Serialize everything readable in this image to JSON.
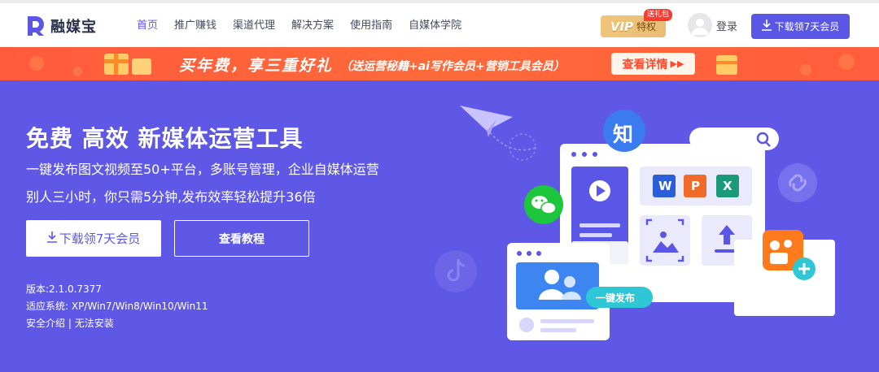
{
  "brand": {
    "name": "融媒宝",
    "logo_color": "#5b57e6"
  },
  "nav": {
    "items": [
      {
        "label": "首页",
        "active": true
      },
      {
        "label": "推广赚钱",
        "active": false
      },
      {
        "label": "渠道代理",
        "active": false
      },
      {
        "label": "解决方案",
        "active": false
      },
      {
        "label": "使用指南",
        "active": false
      },
      {
        "label": "自媒体学院",
        "active": false
      }
    ]
  },
  "vip": {
    "logo": "VIP",
    "label": "特权",
    "badge": "送礼包"
  },
  "login": {
    "label": "登录"
  },
  "header_download": {
    "label": "下载领7天会员",
    "icon": "download-icon"
  },
  "promo": {
    "main_text": "买年费，享三重好礼",
    "sub_text": "（送运营秘籍+ai写作会员+营销工具会员）",
    "button_label": "查看详情",
    "button_icon": "double-arrow-icon",
    "background": "#ff5a3c"
  },
  "hero": {
    "title": "免费 高效 新媒体运营工具",
    "subtitle_1": "一键发布图文视频至50+平台，多账号管理，企业自媒体运营",
    "subtitle_2": "别人三小时，你只需5分钟,发布效率轻松提升36倍",
    "primary_button": "下载领7天会员",
    "secondary_button": "查看教程",
    "version": "版本:2.1.0.7377",
    "systems": "适应系统:  XP/Win7/Win8/Win10/Win11",
    "security_link": "安全介绍",
    "separator": " | ",
    "install_link": "无法安装",
    "background": "#5f58e6"
  },
  "illustration": {
    "zhihu_label": "知",
    "word_label": "W",
    "ppt_label": "P",
    "excel_label": "X",
    "publish_label": "一键发布",
    "colors": {
      "zhihu": "#3a7bf0",
      "word": "#2b5fd9",
      "ppt": "#f06a2a",
      "excel": "#1a9a78",
      "wechat": "#1dc63c",
      "kuaishou": "#ff7a1a",
      "publish": "#2fc7d5"
    }
  }
}
